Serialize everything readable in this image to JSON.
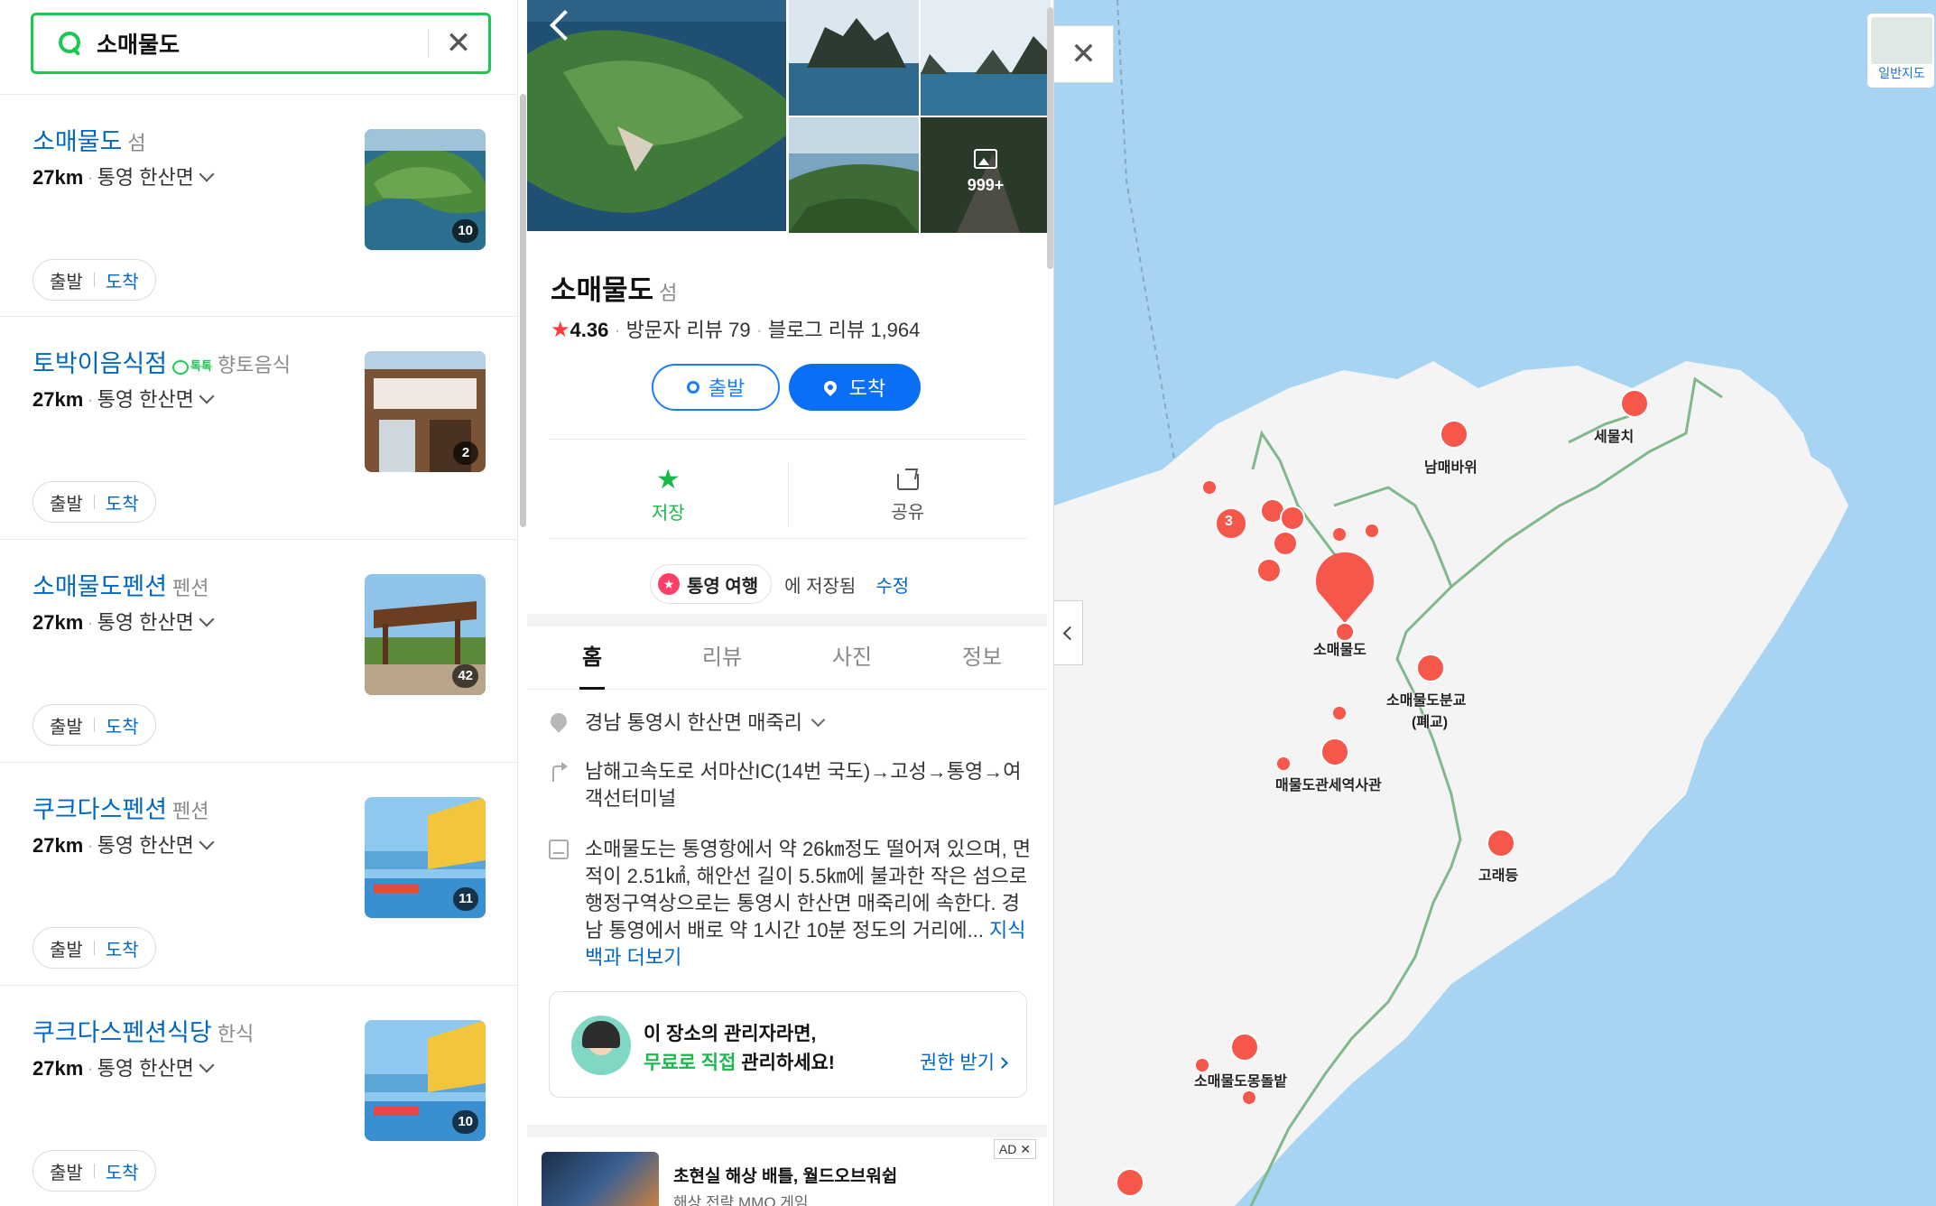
{
  "search": {
    "query": "소매물도"
  },
  "results": [
    {
      "title": "소매물도",
      "category": "섬",
      "talk": "",
      "distance": "27km",
      "region": "통영 한산면",
      "photo_count": "10",
      "start": "출발",
      "arrive": "도착"
    },
    {
      "title": "토박이음식점",
      "category": "향토음식",
      "talk": "톡톡",
      "distance": "27km",
      "region": "통영 한산면",
      "photo_count": "2",
      "start": "출발",
      "arrive": "도착"
    },
    {
      "title": "소매물도펜션",
      "category": "펜션",
      "talk": "",
      "distance": "27km",
      "region": "통영 한산면",
      "photo_count": "42",
      "start": "출발",
      "arrive": "도착"
    },
    {
      "title": "쿠크다스펜션",
      "category": "펜션",
      "talk": "",
      "distance": "27km",
      "region": "통영 한산면",
      "photo_count": "11",
      "start": "출발",
      "arrive": "도착"
    },
    {
      "title": "쿠크다스펜션식당",
      "category": "한식",
      "talk": "",
      "distance": "27km",
      "region": "통영 한산면",
      "photo_count": "10",
      "start": "출발",
      "arrive": "도착"
    }
  ],
  "detail": {
    "more_photos": "999+",
    "title": "소매물도",
    "category": "섬",
    "rating": "4.36",
    "visitor_reviews": "방문자 리뷰 79",
    "blog_reviews": "블로그 리뷰 1,964",
    "start_label": "출발",
    "arrive_label": "도착",
    "save_label": "저장",
    "share_label": "공유",
    "saved_list": "통영 여행",
    "saved_text": "에 저장됨",
    "edit_label": "수정",
    "tabs": [
      "홈",
      "리뷰",
      "사진",
      "정보"
    ],
    "address": "경남 통영시 한산면 매죽리",
    "directions": "남해고속도로 서마산IC(14번 국도)→고성→통영→여객선터미널",
    "description": "소매물도는 통영항에서 약 26㎞정도 떨어져 있으며, 면적이 2.51㎢, 해안선 길이 5.5㎞에 불과한 작은 섬으로 행정구역상으로는 통영시 한산면 매죽리에 속한다. 경남 통영에서 배로 약 1시간 10분 정도의 거리에...",
    "description_more": "지식백과 더보기",
    "owner_line1": "이 장소의 관리자라면,",
    "owner_green": "무료로 직접",
    "owner_rest": " 관리하세요!",
    "owner_cta": "권한 받기",
    "ad_badge": "AD",
    "ad_title": "초현실 해상 배틀, 월드오브워쉽",
    "ad_sub": "해상 전략 MMO 게임"
  },
  "map": {
    "type_label": "일반지도",
    "route_label": "소매물도",
    "labels": {
      "semulchi": "세물치",
      "nammaebawi": "남매바위",
      "somaemuldo": "소매물도",
      "school": "소매물도분교",
      "school_note": "(폐교)",
      "museum": "매물도관세역사관",
      "goraedeung": "고래등",
      "mongdol": "소매물도몽돌밭"
    },
    "cluster_count": "3",
    "colors": {
      "land": "#f4f4f4",
      "sea": "#a6d4f2",
      "marker": "#f5584a",
      "trail": "#7fb98a"
    }
  }
}
